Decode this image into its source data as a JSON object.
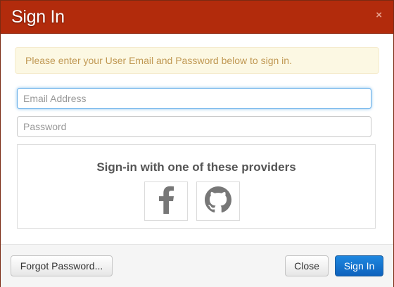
{
  "modal": {
    "title": "Sign In",
    "close_glyph": "×"
  },
  "alert": {
    "text": "Please enter your User Email and Password below to sign in."
  },
  "form": {
    "email_placeholder": "Email Address",
    "password_placeholder": "Password"
  },
  "providers": {
    "heading": "Sign-in with one of these providers",
    "items": [
      {
        "icon": "facebook-icon"
      },
      {
        "icon": "github-icon"
      }
    ]
  },
  "footer": {
    "forgot_label": "Forgot Password...",
    "close_label": "Close",
    "signin_label": "Sign In"
  },
  "colors": {
    "header_bg": "#b22b0c",
    "alert_bg": "#fcf8e3",
    "alert_text": "#c09853",
    "primary": "#1a74d0",
    "icon_gray": "#777777"
  }
}
